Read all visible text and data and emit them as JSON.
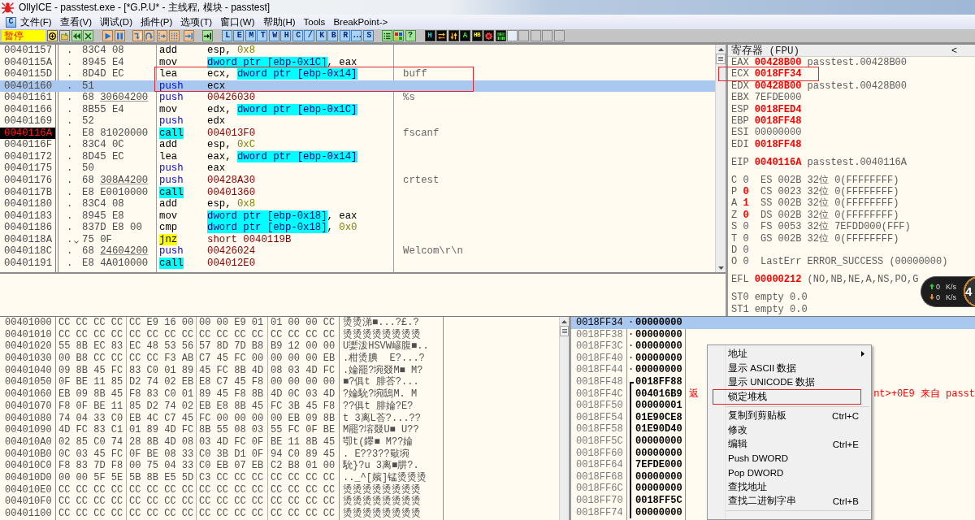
{
  "window": {
    "title": "OllyICE - passtest.exe - [*G.P.U* - 主线程, 模块 - passtest]"
  },
  "menu_bar": {
    "child_icon_label": "C",
    "items": [
      "文件(F)",
      "查看(V)",
      "调试(D)",
      "插件(P)",
      "选项(T)",
      "窗口(W)",
      "帮助(H)",
      "Tools",
      "BreakPoint->"
    ]
  },
  "toolbar": {
    "status": "暂停",
    "window_buttons": [
      "L",
      "E",
      "M",
      "T",
      "W",
      "H",
      "C",
      "/",
      "K",
      "B",
      "R",
      "...",
      "S"
    ],
    "help_button": "?",
    "plugin_buttons": [
      "H",
      "A",
      "HB"
    ]
  },
  "disassembly": {
    "rows": [
      {
        "address": "00401157",
        "marker": ".",
        "jump_arrow": false,
        "bytes": "83C4 08",
        "mnemonic": {
          "text": "add",
          "kind": "plain"
        },
        "operands": [
          {
            "text": "esp, ",
            "kind": "plain"
          },
          {
            "text": "0x8",
            "kind": "imm"
          }
        ],
        "selected": false,
        "eip": false,
        "boxed": false
      },
      {
        "address": "0040115A",
        "marker": ".",
        "jump_arrow": false,
        "bytes": "8945 E4",
        "mnemonic": {
          "text": "mov",
          "kind": "plain"
        },
        "operands": [
          {
            "text": "dword ptr [ebp-0x1C]",
            "kind": "mem"
          },
          {
            "text": ", eax",
            "kind": "plain"
          }
        ],
        "selected": false,
        "eip": false,
        "boxed": false
      },
      {
        "address": "0040115D",
        "marker": ".",
        "jump_arrow": false,
        "bytes": "8D4D EC",
        "mnemonic": {
          "text": "lea",
          "kind": "plain"
        },
        "operands": [
          {
            "text": "ecx, ",
            "kind": "plain"
          },
          {
            "text": "dword ptr [ebp-0x14]",
            "kind": "mem"
          }
        ],
        "comment": "buff",
        "selected": false,
        "eip": false,
        "boxed": true
      },
      {
        "address": "00401160",
        "marker": ".",
        "jump_arrow": false,
        "bytes": "51",
        "mnemonic": {
          "text": "push",
          "kind": "push"
        },
        "operands": [
          {
            "text": "ecx",
            "kind": "plain"
          }
        ],
        "selected": true,
        "eip": false,
        "boxed": true
      },
      {
        "address": "00401161",
        "marker": ".",
        "jump_arrow": false,
        "bytes": "68",
        "fixup": "30604200",
        "mnemonic": {
          "text": "push",
          "kind": "push"
        },
        "operands": [
          {
            "text": "00426030",
            "kind": "addr"
          }
        ],
        "comment": "%s",
        "selected": false,
        "eip": false,
        "boxed": false
      },
      {
        "address": "00401166",
        "marker": ".",
        "jump_arrow": false,
        "bytes": "8B55 E4",
        "mnemonic": {
          "text": "mov",
          "kind": "plain"
        },
        "operands": [
          {
            "text": "edx, ",
            "kind": "plain"
          },
          {
            "text": "dword ptr [ebp-0x1C]",
            "kind": "mem"
          }
        ],
        "selected": false,
        "eip": false,
        "boxed": false
      },
      {
        "address": "00401169",
        "marker": ".",
        "jump_arrow": false,
        "bytes": "52",
        "mnemonic": {
          "text": "push",
          "kind": "push"
        },
        "operands": [
          {
            "text": "edx",
            "kind": "plain"
          }
        ],
        "selected": false,
        "eip": false,
        "boxed": false
      },
      {
        "address": "0040116A",
        "marker": ".",
        "jump_arrow": false,
        "bytes": "E8 81020000",
        "mnemonic": {
          "text": "call",
          "kind": "call"
        },
        "operands": [
          {
            "text": "004013F0",
            "kind": "addr"
          }
        ],
        "comment": "fscanf",
        "selected": false,
        "eip": true,
        "boxed": false
      },
      {
        "address": "0040116F",
        "marker": ".",
        "jump_arrow": false,
        "bytes": "83C4 0C",
        "mnemonic": {
          "text": "add",
          "kind": "plain"
        },
        "operands": [
          {
            "text": "esp, ",
            "kind": "plain"
          },
          {
            "text": "0xC",
            "kind": "imm"
          }
        ],
        "selected": false,
        "eip": false,
        "boxed": false
      },
      {
        "address": "00401172",
        "marker": ".",
        "jump_arrow": false,
        "bytes": "8D45 EC",
        "mnemonic": {
          "text": "lea",
          "kind": "plain"
        },
        "operands": [
          {
            "text": "eax, ",
            "kind": "plain"
          },
          {
            "text": "dword ptr [ebp-0x14]",
            "kind": "mem"
          }
        ],
        "selected": false,
        "eip": false,
        "boxed": false
      },
      {
        "address": "00401175",
        "marker": ".",
        "jump_arrow": false,
        "bytes": "50",
        "mnemonic": {
          "text": "push",
          "kind": "push"
        },
        "operands": [
          {
            "text": "eax",
            "kind": "plain"
          }
        ],
        "selected": false,
        "eip": false,
        "boxed": false
      },
      {
        "address": "00401176",
        "marker": ".",
        "jump_arrow": false,
        "bytes": "68",
        "fixup": "308A4200",
        "mnemonic": {
          "text": "push",
          "kind": "push"
        },
        "operands": [
          {
            "text": "00428A30",
            "kind": "addr"
          }
        ],
        "comment": "crtest",
        "selected": false,
        "eip": false,
        "boxed": false
      },
      {
        "address": "0040117B",
        "marker": ".",
        "jump_arrow": false,
        "bytes": "E8 E0010000",
        "mnemonic": {
          "text": "call",
          "kind": "call"
        },
        "operands": [
          {
            "text": "00401360",
            "kind": "addr"
          }
        ],
        "selected": false,
        "eip": false,
        "boxed": false
      },
      {
        "address": "00401180",
        "marker": ".",
        "jump_arrow": false,
        "bytes": "83C4 08",
        "mnemonic": {
          "text": "add",
          "kind": "plain"
        },
        "operands": [
          {
            "text": "esp, ",
            "kind": "plain"
          },
          {
            "text": "0x8",
            "kind": "imm"
          }
        ],
        "selected": false,
        "eip": false,
        "boxed": false
      },
      {
        "address": "00401183",
        "marker": ".",
        "jump_arrow": false,
        "bytes": "8945 E8",
        "mnemonic": {
          "text": "mov",
          "kind": "plain"
        },
        "operands": [
          {
            "text": "dword ptr [ebp-0x18]",
            "kind": "mem"
          },
          {
            "text": ", eax",
            "kind": "plain"
          }
        ],
        "selected": false,
        "eip": false,
        "boxed": false
      },
      {
        "address": "00401186",
        "marker": ".",
        "jump_arrow": false,
        "bytes": "837D E8 00",
        "mnemonic": {
          "text": "cmp",
          "kind": "plain"
        },
        "operands": [
          {
            "text": "dword ptr [ebp-0x18]",
            "kind": "mem"
          },
          {
            "text": ", ",
            "kind": "plain"
          },
          {
            "text": "0x0",
            "kind": "imm"
          }
        ],
        "selected": false,
        "eip": false,
        "boxed": false
      },
      {
        "address": "0040118A",
        "marker": ".",
        "jump_arrow": true,
        "bytes": "75 0F",
        "mnemonic": {
          "text": "jnz",
          "kind": "jump"
        },
        "operands": [
          {
            "text": "short 0040119B",
            "kind": "addr"
          }
        ],
        "selected": false,
        "eip": false,
        "boxed": false
      },
      {
        "address": "0040118C",
        "marker": ".",
        "jump_arrow": false,
        "bytes": "68",
        "fixup": "24604200",
        "mnemonic": {
          "text": "push",
          "kind": "push"
        },
        "operands": [
          {
            "text": "00426024",
            "kind": "addr"
          }
        ],
        "comment": "Welcom\\r\\n",
        "selected": false,
        "eip": false,
        "boxed": false
      },
      {
        "address": "00401191",
        "marker": ".",
        "jump_arrow": false,
        "bytes": "E8 4A010000",
        "mnemonic": {
          "text": "call",
          "kind": "call"
        },
        "operands": [
          {
            "text": "004012E0",
            "kind": "addr"
          }
        ],
        "selected": false,
        "eip": false,
        "boxed": false
      }
    ]
  },
  "registers": {
    "title": "寄存器 (FPU)",
    "collapse_button": "<",
    "general": [
      {
        "name": "EAX",
        "value": "00428B00",
        "changed": true,
        "info": "passtest.00428B00",
        "boxed": false
      },
      {
        "name": "ECX",
        "value": "0018FF34",
        "changed": true,
        "boxed": true
      },
      {
        "name": "EDX",
        "value": "00428B00",
        "changed": true,
        "info": "passtest.00428B00",
        "boxed": false
      },
      {
        "name": "EBX",
        "value": "7EFDE000",
        "changed": false,
        "boxed": false
      },
      {
        "name": "ESP",
        "value": "0018FED4",
        "changed": true,
        "boxed": false
      },
      {
        "name": "EBP",
        "value": "0018FF48",
        "changed": true,
        "boxed": false
      },
      {
        "name": "ESI",
        "value": "00000000",
        "changed": false,
        "boxed": false
      },
      {
        "name": "EDI",
        "value": "0018FF48",
        "changed": true,
        "boxed": false
      }
    ],
    "eip": {
      "name": "EIP",
      "value": "0040116A",
      "changed": true,
      "info": "passtest.0040116A"
    },
    "flags": [
      {
        "name": "C",
        "value": "0",
        "changed": false,
        "segment": {
          "name": "ES",
          "selector": "002B",
          "bits": "32位",
          "base": "0(FFFFFFFF)"
        }
      },
      {
        "name": "P",
        "value": "0",
        "changed": true,
        "segment": {
          "name": "CS",
          "selector": "0023",
          "bits": "32位",
          "base": "0(FFFFFFFF)"
        }
      },
      {
        "name": "A",
        "value": "1",
        "changed": true,
        "segment": {
          "name": "SS",
          "selector": "002B",
          "bits": "32位",
          "base": "0(FFFFFFFF)"
        }
      },
      {
        "name": "Z",
        "value": "0",
        "changed": true,
        "segment": {
          "name": "DS",
          "selector": "002B",
          "bits": "32位",
          "base": "0(FFFFFFFF)"
        }
      },
      {
        "name": "S",
        "value": "0",
        "changed": false,
        "segment": {
          "name": "FS",
          "selector": "0053",
          "bits": "32位",
          "base": "7EFDD000(FFF)"
        }
      },
      {
        "name": "T",
        "value": "0",
        "changed": false,
        "segment": {
          "name": "GS",
          "selector": "002B",
          "bits": "32位",
          "base": "0(FFFFFFFF)"
        }
      },
      {
        "name": "D",
        "value": "0",
        "changed": false
      },
      {
        "name": "O",
        "value": "0",
        "changed": false,
        "last_error": {
          "label": "LastErr",
          "value": "ERROR_SUCCESS (00000000)"
        }
      }
    ],
    "efl": {
      "name": "EFL",
      "value": "00000212",
      "changed": true,
      "info": "(NO,NB,NE,A,NS,PO,G"
    },
    "fpu": [
      {
        "name": "ST0",
        "tag": "empty",
        "value": "0.0"
      },
      {
        "name": "ST1",
        "tag": "empty",
        "value": "0.0"
      }
    ]
  },
  "dump": {
    "rows": [
      {
        "address": "00401000",
        "hex": [
          "CC CC CC CC",
          "CC E9 16 00",
          "00 00 E9 01",
          "01 00 00 CC"
        ],
        "ascii": "烫烫涕■...?£.?"
      },
      {
        "address": "00401010",
        "hex": [
          "CC CC CC CC",
          "CC CC CC CC",
          "CC CC CC CC",
          "CC CC CC CC"
        ],
        "ascii": "烫烫烫烫烫烫烫烫"
      },
      {
        "address": "00401020",
        "hex": [
          "55 8B EC 83",
          "EC 48 53 56",
          "57 8D 7D B8",
          "B9 12 00 00"
        ],
        "ascii": "U嬱泼HSVW嵃腹■.."
      },
      {
        "address": "00401030",
        "hex": [
          "00 B8 CC CC",
          "CC CC F3 AB",
          "C7 45 FC 00",
          "00 00 00 EB"
        ],
        "ascii": ".柑烫腆  E?...?"
      },
      {
        "address": "00401040",
        "hex": [
          "09 8B 45 FC",
          "83 C0 01 89",
          "45 FC 8B 4D",
          "08 03 4D FC"
        ],
        "ascii": ".婨罷?埦叕M■ M?"
      },
      {
        "address": "00401050",
        "hex": [
          "0F BE 11 85",
          "D2 74 02 EB",
          "E8 C7 45 F8",
          "00 00 00 00"
        ],
        "ascii": "■?俱t 腓荅?..."
      },
      {
        "address": "00401060",
        "hex": [
          "EB 09 8B 45",
          "F8 83 C0 01",
          "89 45 F8 8B",
          "4D 0C 03 4D"
        ],
        "ascii": "?婨馻?埦鴟M. M"
      },
      {
        "address": "00401070",
        "hex": [
          "F8 0F BE 11",
          "85 D2 74 02",
          "EB E8 8B 45",
          "FC 3B 45 F8"
        ],
        "ascii": "??俱t 腓婨?E?"
      },
      {
        "address": "00401080",
        "hex": [
          "74 04 33 C0",
          "EB 4C C7 45",
          "FC 00 00 00",
          "00 EB 09 8B"
        ],
        "ascii": "t 3离L荅?...??"
      },
      {
        "address": "00401090",
        "hex": [
          "4D FC 83 C1",
          "01 89 4D FC",
          "8B 55 08 03",
          "55 FC 0F BE"
        ],
        "ascii": "M罷?塎叕U■ U??"
      },
      {
        "address": "004010A0",
        "hex": [
          "02 85 C0 74",
          "28 8B 4D 08",
          "03 4D FC 0F",
          "BE 11 8B 45"
        ],
        "ascii": "卾t(鑻■ M??婨"
      },
      {
        "address": "004010B0",
        "hex": [
          "0C 03 45 FC",
          "0F BE 08 33",
          "C0 3B D1 0F",
          "94 C0 89 45"
        ],
        "ascii": ". E??3??斀埦"
      },
      {
        "address": "004010C0",
        "hex": [
          "F8 83 7D F8",
          "00 75 04 33",
          "C0 EB 07 EB",
          "C2 B8 01 00"
        ],
        "ascii": "馻}?u 3离■肼?."
      },
      {
        "address": "004010D0",
        "hex": [
          "00 00 5F 5E",
          "5B 8B E5 5D",
          "C3 CC CC CC",
          "CC CC CC CC"
        ],
        "ascii": ".._^[嬪]锰烫烫烫"
      },
      {
        "address": "004010E0",
        "hex": [
          "CC CC CC CC",
          "CC CC CC CC",
          "CC CC CC CC",
          "CC CC CC CC"
        ],
        "ascii": "烫烫烫烫烫烫烫烫"
      },
      {
        "address": "004010F0",
        "hex": [
          "CC CC CC CC",
          "CC CC CC CC",
          "CC CC CC CC",
          "CC CC CC CC"
        ],
        "ascii": "烫烫烫烫烫烫烫烫"
      },
      {
        "address": "00401100",
        "hex": [
          "CC CC CC CC",
          "CC CC CC CC",
          "CC CC CC CC",
          "CC CC CC CC"
        ],
        "ascii": "烫烫烫烫烫烫烫烫"
      }
    ]
  },
  "stack": {
    "rows": [
      {
        "address": "0018FF34",
        "marker": "·",
        "value": "00000000",
        "kind": "plain",
        "selected": true
      },
      {
        "address": "0018FF38",
        "marker": "·",
        "value": "00000000",
        "kind": "plain",
        "selected": false
      },
      {
        "address": "0018FF3C",
        "marker": "·",
        "value": "00000000",
        "kind": "plain",
        "selected": false
      },
      {
        "address": "0018FF40",
        "marker": "·",
        "value": "00000000",
        "kind": "plain",
        "selected": false
      },
      {
        "address": "0018FF44",
        "marker": "·",
        "value": "00000000",
        "kind": "plain",
        "selected": false
      },
      {
        "address": "0018FF48",
        "value": "0018FF88",
        "kind": "start",
        "selected": false
      },
      {
        "address": "0018FF4C",
        "value": "004016B9",
        "kind": "framed",
        "selected": false,
        "comment_start": "返",
        "comment_end": "nt>+0E9 来自 passt"
      },
      {
        "address": "0018FF50",
        "value": "00000001",
        "kind": "framed",
        "selected": false
      },
      {
        "address": "0018FF54",
        "value": "01E90CE8",
        "kind": "framed",
        "selected": false
      },
      {
        "address": "0018FF58",
        "value": "01E90D40",
        "kind": "framed",
        "selected": false
      },
      {
        "address": "0018FF5C",
        "value": "00000000",
        "kind": "framed",
        "selected": false
      },
      {
        "address": "0018FF60",
        "value": "00000000",
        "kind": "framed",
        "selected": false
      },
      {
        "address": "0018FF64",
        "value": "7EFDE000",
        "kind": "framed",
        "selected": false
      },
      {
        "address": "0018FF68",
        "value": "00000000",
        "kind": "framed",
        "selected": false
      },
      {
        "address": "0018FF6C",
        "value": "00000000",
        "kind": "framed",
        "selected": false
      },
      {
        "address": "0018FF70",
        "value": "0018FF5C",
        "kind": "framed",
        "selected": false
      },
      {
        "address": "0018FF74",
        "value": "00000000",
        "kind": "framed",
        "selected": false
      }
    ]
  },
  "context_menu": {
    "items": [
      {
        "kind": "item",
        "label": "地址",
        "submenu": true,
        "boxed": false
      },
      {
        "kind": "item",
        "label": "显示 ASCII 数据",
        "submenu": false,
        "boxed": false
      },
      {
        "kind": "item",
        "label": "显示 UNICODE 数据",
        "submenu": false,
        "boxed": false
      },
      {
        "kind": "item",
        "label": "锁定堆栈",
        "submenu": false,
        "boxed": true
      },
      {
        "kind": "separator"
      },
      {
        "kind": "item",
        "label": "复制到剪贴板",
        "shortcut": "Ctrl+C",
        "submenu": false,
        "boxed": false
      },
      {
        "kind": "item",
        "label": "修改",
        "submenu": false,
        "boxed": false
      },
      {
        "kind": "item",
        "label": "编辑",
        "shortcut": "Ctrl+E",
        "submenu": false,
        "boxed": false
      },
      {
        "kind": "item",
        "label": "Push DWORD",
        "submenu": false,
        "boxed": false
      },
      {
        "kind": "item",
        "label": "Pop DWORD",
        "submenu": false,
        "boxed": false
      },
      {
        "kind": "item",
        "label": "查找地址",
        "submenu": false,
        "boxed": false
      },
      {
        "kind": "item",
        "label": "查找二进制字串",
        "shortcut": "Ctrl+B",
        "submenu": false,
        "boxed": false
      },
      {
        "kind": "separator"
      }
    ]
  },
  "speed_widget": {
    "upload": {
      "value": "0",
      "unit": "K/s"
    },
    "download": {
      "value": "0",
      "unit": "K/s"
    },
    "ball_label": "4"
  }
}
